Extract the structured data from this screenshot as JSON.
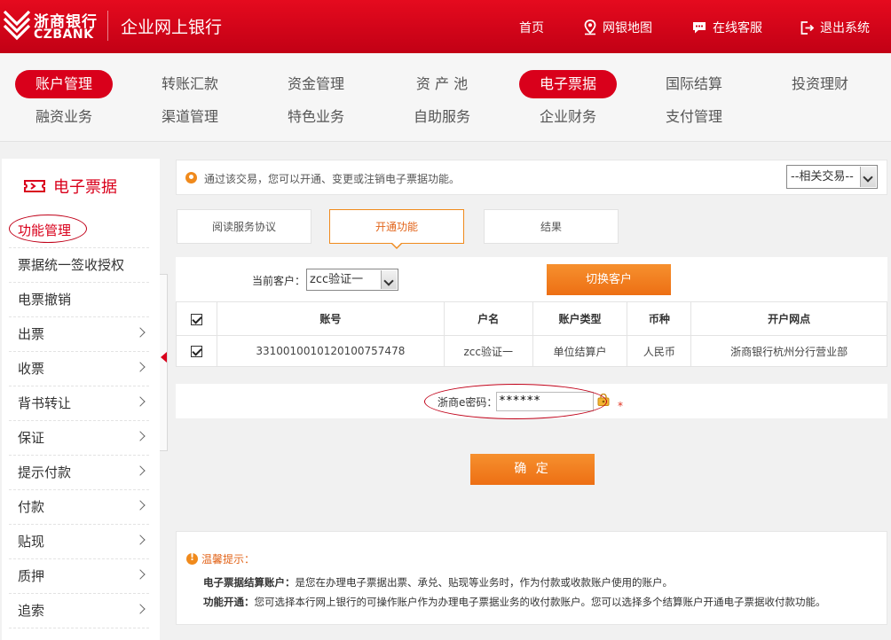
{
  "header": {
    "logo_cn": "浙商银行",
    "logo_en": "CZBANK",
    "title": "企业网上银行",
    "nav": [
      {
        "label": "首页",
        "icon": "none"
      },
      {
        "label": "网银地图",
        "icon": "map-pin-icon"
      },
      {
        "label": "在线客服",
        "icon": "chat-icon"
      },
      {
        "label": "退出系统",
        "icon": "logout-icon"
      }
    ]
  },
  "menu": {
    "row1": [
      "账户管理",
      "转账汇款",
      "资金管理",
      "资 产 池",
      "电子票据",
      "国际结算",
      "投资理财"
    ],
    "row2": [
      "融资业务",
      "渠道管理",
      "特色业务",
      "自助服务",
      "企业财务",
      "支付管理"
    ],
    "active": [
      "账户管理",
      "电子票据"
    ]
  },
  "sidebar": {
    "title": "电子票据",
    "items": [
      {
        "label": "功能管理",
        "chevron": false
      },
      {
        "label": "票据统一签收授权",
        "chevron": false
      },
      {
        "label": "电票撤销",
        "chevron": false
      },
      {
        "label": "出票",
        "chevron": true
      },
      {
        "label": "收票",
        "chevron": true
      },
      {
        "label": "背书转让",
        "chevron": true
      },
      {
        "label": "保证",
        "chevron": true
      },
      {
        "label": "提示付款",
        "chevron": true
      },
      {
        "label": "付款",
        "chevron": true
      },
      {
        "label": "贴现",
        "chevron": true
      },
      {
        "label": "质押",
        "chevron": true
      },
      {
        "label": "追索",
        "chevron": true
      }
    ]
  },
  "notice": {
    "text": "通过该交易，您可以开通、变更或注销电子票据功能。",
    "related_select": "--相关交易--"
  },
  "steps": [
    "阅读服务协议",
    "开通功能",
    "结果"
  ],
  "customer": {
    "label": "当前客户：",
    "selected": "zcc验证一",
    "switch_button": "切换客户"
  },
  "table": {
    "headers": [
      "账号",
      "户名",
      "账户类型",
      "币种",
      "开户网点"
    ],
    "rows": [
      {
        "checked": true,
        "account": "331001001012010075747 8",
        "name": "zcc验证一",
        "type": "单位结算户",
        "currency": "人民币",
        "branch": "浙商银行杭州分行营业部"
      }
    ]
  },
  "password": {
    "label": "浙商e密码：",
    "value": "******",
    "required_mark": "*"
  },
  "confirm_button": "确 定",
  "tips": {
    "title": "温馨提示：",
    "lines": [
      {
        "term": "电子票据结算账户：",
        "text": "是您在办理电子票据出票、承兑、贴现等业务时，作为付款或收款账户使用的账户。"
      },
      {
        "term": "功能开通：",
        "text": "您可选择本行网上银行的可操作账户作为办理电子票据业务的收付款账户。您可以选择多个结算账户开通电子票据收付款功能。"
      }
    ]
  },
  "colors": {
    "brand_red": "#d9001b",
    "accent_orange": "#ee7318"
  }
}
